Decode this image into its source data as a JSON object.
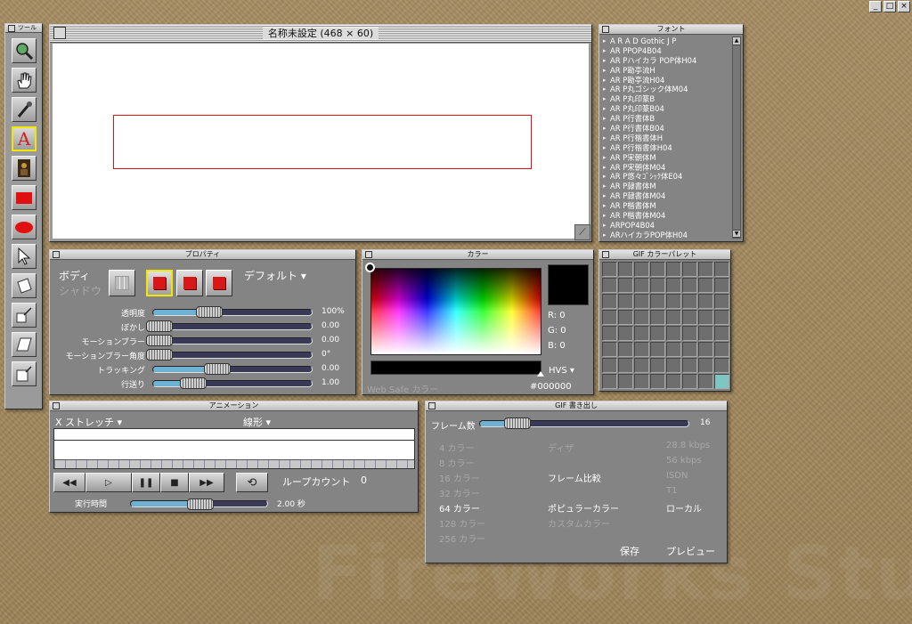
{
  "app": {
    "watermark": "FireWorks Studio"
  },
  "window_controls": [
    "_",
    "□",
    "×"
  ],
  "tools": {
    "title": "ツール",
    "items": [
      {
        "name": "zoom",
        "glyph": "🔍"
      },
      {
        "name": "hand",
        "glyph": "✋"
      },
      {
        "name": "eyedropper",
        "glyph": "🖋"
      },
      {
        "name": "text",
        "glyph": "A",
        "selected": true
      },
      {
        "name": "image",
        "glyph": "▮"
      },
      {
        "name": "rectangle",
        "glyph": "■"
      },
      {
        "name": "ellipse",
        "glyph": "●"
      },
      {
        "name": "pointer",
        "glyph": "↖"
      },
      {
        "name": "transform-1",
        "glyph": "◧"
      },
      {
        "name": "transform-2",
        "glyph": "⬔"
      },
      {
        "name": "transform-3",
        "glyph": "▱"
      },
      {
        "name": "transform-4",
        "glyph": "⬓"
      }
    ]
  },
  "canvas": {
    "title": "名称未設定 (468 × 60)"
  },
  "font_panel": {
    "title": "フォント",
    "fonts": [
      "A R A D Gothic J P",
      "AR PPOP4B04",
      "AR Pハイカラ POP体H04",
      "AR P勘亭流H",
      "AR P勘亭流H04",
      "AR P丸ゴシック体M04",
      "AR P丸印篆B",
      "AR P丸印篆B04",
      "AR P行書体B",
      "AR P行書体B04",
      "AR P行楷書体H",
      "AR P行楷書体H04",
      "AR P宋朝体M",
      "AR P宋朝体M04",
      "AR P悠々ｺﾞｼｯｸ体E04",
      "AR P隷書体M",
      "AR P隷書体M04",
      "AR P楷書体M",
      "AR P楷書体M04",
      "ARPOP4B04",
      "ARハイカラPOP体H04"
    ]
  },
  "properties": {
    "title": "プロパティ",
    "body_label": "ボディ",
    "shadow_label": "シャドウ",
    "preset_label": "デフォルト ▾",
    "sliders": [
      {
        "label": "透明度",
        "value": "100%",
        "fill": 0.35
      },
      {
        "label": "ぼかし",
        "value": "0.00",
        "fill": 0.04
      },
      {
        "label": "モーションブラー",
        "value": "0.00",
        "fill": 0.04
      },
      {
        "label": "モーションブラー角度",
        "value": "0°",
        "fill": 0.04
      },
      {
        "label": "トラッキング",
        "value": "0.00",
        "fill": 0.4
      },
      {
        "label": "行送り",
        "value": "1.00",
        "fill": 0.25
      }
    ]
  },
  "color": {
    "title": "カラー",
    "r": "R: 0",
    "g": "G: 0",
    "b": "B: 0",
    "mode": "HVS ▾",
    "websafe": "Web Safe カラー",
    "hex": "#000000",
    "current": "#000000"
  },
  "palette": {
    "title": "GIF カラーパレット"
  },
  "animation": {
    "title": "アニメーション",
    "effect": "X ストレッチ ▾",
    "curve": "線形 ▾",
    "loop_label": "ループカウント",
    "loop_value": "0",
    "time_label": "実行時間",
    "time_value": "2.00 秒",
    "time_fill": 0.5,
    "buttons": [
      "◀◀",
      "▷",
      "❚❚",
      "■",
      "▶▶",
      "⟲"
    ]
  },
  "gif_export": {
    "title": "GIF 書き出し",
    "frames_label": "フレーム数",
    "frames_value": "16",
    "frames_fill": 0.18,
    "colors": [
      "4 カラー",
      "8 カラー",
      "16 カラー",
      "32 カラー",
      "64 カラー",
      "128 カラー",
      "256 カラー"
    ],
    "dither": "ディザ",
    "frame_compare": "フレーム比較",
    "popular": "ポピュラーカラー",
    "custom": "カスタムカラー",
    "speeds": [
      "28.8 kbps",
      "56 kbps",
      "ISDN",
      "T1"
    ],
    "local": "ローカル",
    "save": "保存",
    "preview": "プレビュー"
  }
}
